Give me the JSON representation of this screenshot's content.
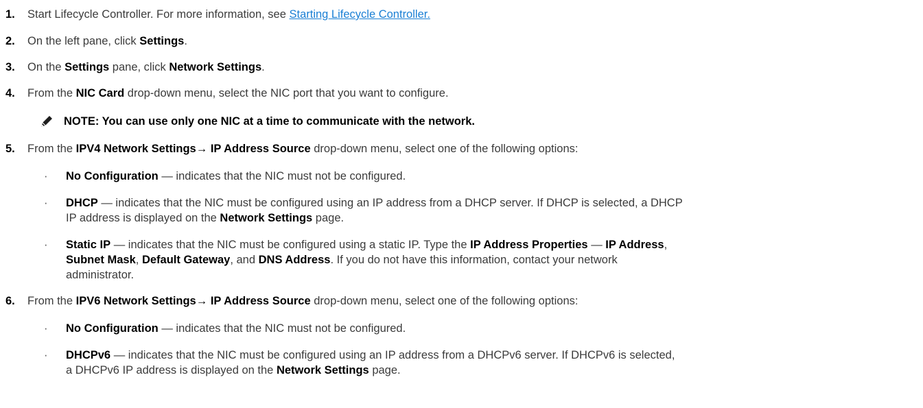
{
  "steps": [
    {
      "num": "1.",
      "a": "Start Lifecycle Controller. For more information, see ",
      "link": "Starting Lifecycle Controller."
    },
    {
      "num": "2.",
      "a": "On the left pane, click ",
      "b1": "Settings",
      "c": "."
    },
    {
      "num": "3.",
      "a": "On the ",
      "b1": "Settings",
      "c": " pane, click ",
      "b2": "Network Settings",
      "d": "."
    },
    {
      "num": "4.",
      "a": "From the ",
      "b1": "NIC Card",
      "c": " drop-down menu, select the NIC port that you want to configure."
    },
    {
      "num": "5.",
      "a": "From the ",
      "b1": "IPV4 Network Settings→ IP Address Source",
      "c": " drop-down menu, select one of the following options:"
    },
    {
      "num": "6.",
      "a": "From the ",
      "b1": "IPV6 Network Settings→ IP Address Source",
      "c": " drop-down menu, select one of the following options:"
    }
  ],
  "note": "NOTE: You can use only one NIC at a time to communicate with the network.",
  "ipv4_options": [
    {
      "bold": "No Configuration",
      "text": " — indicates that the NIC must not be configured."
    },
    {
      "bold": "DHCP",
      "text": " — indicates that the NIC must be configured using an IP address from a DHCP server. If DHCP is selected, a DHCP",
      "line2a": "IP address is displayed on the ",
      "line2b": "Network Settings",
      "line2c": " page."
    },
    {
      "bold": "Static IP",
      "t1": " — indicates that the NIC must be configured using a static IP. Type the ",
      "b2": "IP Address Properties",
      "t2": " — ",
      "b3": "IP Address",
      "t3": ",",
      "b4": "Subnet Mask",
      "t4": ", ",
      "b5": "Default Gateway",
      "t5": ", and ",
      "b6": "DNS Address",
      "t6": ". If you do not have this information, contact your network",
      "line3": "administrator."
    }
  ],
  "ipv6_options": [
    {
      "bold": "No Configuration",
      "text": " — indicates that the NIC must not be configured."
    },
    {
      "bold": "DHCPv6",
      "text": " — indicates that the NIC must be configured using an IP address from a DHCPv6 server. If DHCPv6 is selected,",
      "line2a": "a DHCPv6 IP address is displayed on the ",
      "line2b": "Network Settings",
      "line2c": " page."
    }
  ],
  "bullet": "·",
  "icons": {
    "note": "pencil-note-icon"
  }
}
